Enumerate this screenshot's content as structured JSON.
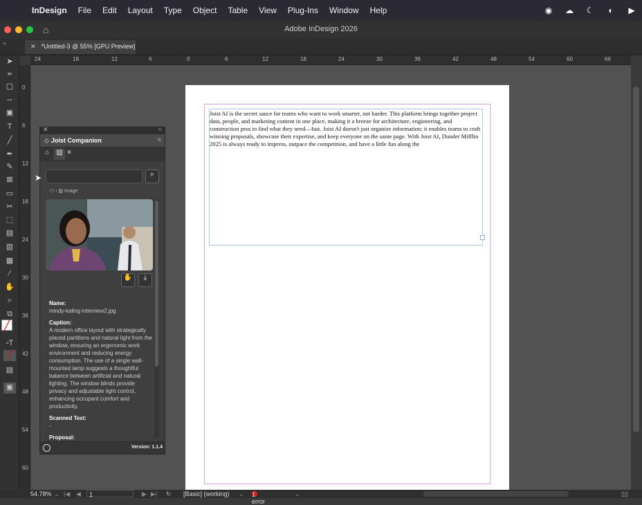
{
  "menubar": {
    "apple": "",
    "items": [
      "InDesign",
      "File",
      "Edit",
      "Layout",
      "Type",
      "Object",
      "Table",
      "View",
      "Plug-Ins",
      "Window",
      "Help"
    ]
  },
  "window": {
    "title": "Adobe InDesign 2026",
    "doc_tab": "*Untitled-3 @ 55% [GPU Preview]"
  },
  "ruler_top": [
    "24",
    "18",
    "12",
    "6",
    "0",
    "6",
    "12",
    "18",
    "24",
    "30",
    "36",
    "42",
    "48",
    "54",
    "60",
    "66"
  ],
  "ruler_left": [
    "0",
    "6",
    "12",
    "18",
    "24",
    "30",
    "36",
    "42",
    "48",
    "54",
    "60"
  ],
  "document": {
    "body_text": "Joist AI is the secret sauce for teams who want to work smarter, not harder. This platform brings together project data, people, and marketing content in one place, making it a breeze for architecture, engineering, and construction pros to find what they need—fast. Joist AI doesn't just organize information; it enables teams to craft winning proposals, showcase their expertise, and keep everyone on the same page. With Joist AI, Dunder Mifflin 2025 is always ready to impress, outpace the competition, and have a little fun along the"
  },
  "panel": {
    "title": "Joist Companion",
    "breadcrumb": "Image",
    "name_label": "Name:",
    "name_value": "mindy-kaling-interview2.jpg",
    "caption_label": "Caption:",
    "caption_value": "A modern office layout with strategically placed partitions and natural light from the window, ensuring an ergonomic work environment and reducing energy consumption. The use of a single wall-mounted lamp suggests a thoughtful balance between artificial and natural lighting. The window blinds provide privacy and adjustable light control, enhancing occupant comfort and productivity.",
    "scanned_label": "Scanned Text:",
    "scanned_value": "-",
    "proposal_label": "Proposal:",
    "proposal_value": "-",
    "version": "Version: 1.1.4"
  },
  "status": {
    "zoom": "54.78%",
    "page": "1",
    "preflight_profile": "[Basic] (working)",
    "errors": "1 error"
  }
}
